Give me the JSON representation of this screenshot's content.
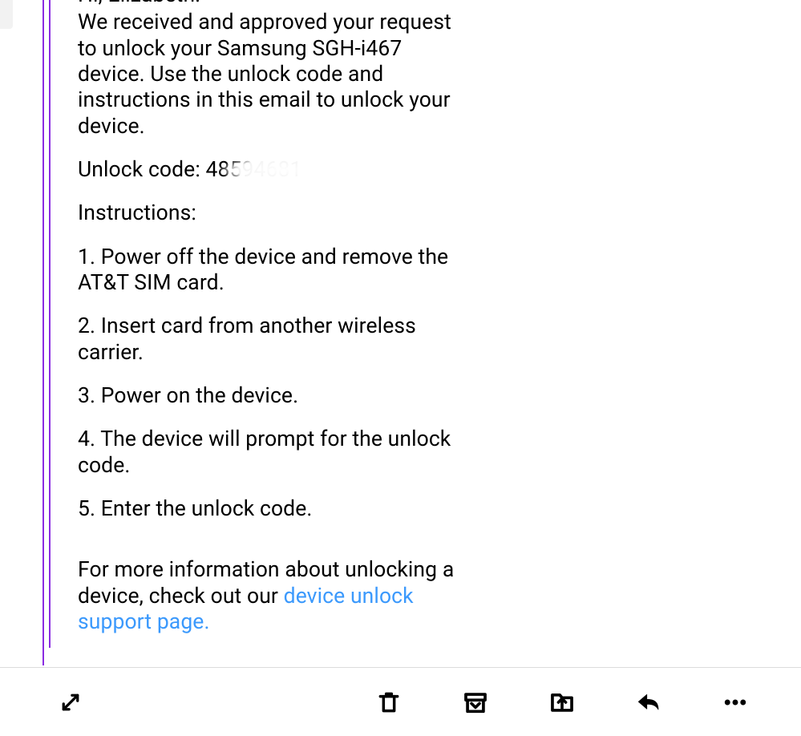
{
  "email": {
    "greeting": "Hi, Elizabeth.",
    "intro": "We received and approved your request to unlock your Samsung SGH-i467 device. Use the unlock code and instructions in this email to unlock your device.",
    "unlock_code_label": "Unlock code:",
    "unlock_code_value": "48594681",
    "instructions_heading": "Instructions:",
    "steps": [
      "1. Power off the device and remove the AT&T SIM card.",
      "2. Insert card from another wireless carrier.",
      "3. Power on the device.",
      "4. The device will prompt for the unlock code.",
      "5. Enter the unlock code."
    ],
    "more_info_prefix": "For more information about unlocking a device, check out our ",
    "more_info_link_text": "device unlock support page.",
    "link_color": "#3b99fc",
    "quote_border_color": "#8a2be2"
  },
  "toolbar": {
    "expand": "expand-icon",
    "delete": "trash-icon",
    "archive": "archive-icon",
    "move": "move-to-icon",
    "reply": "reply-icon",
    "more": "more-icon"
  }
}
